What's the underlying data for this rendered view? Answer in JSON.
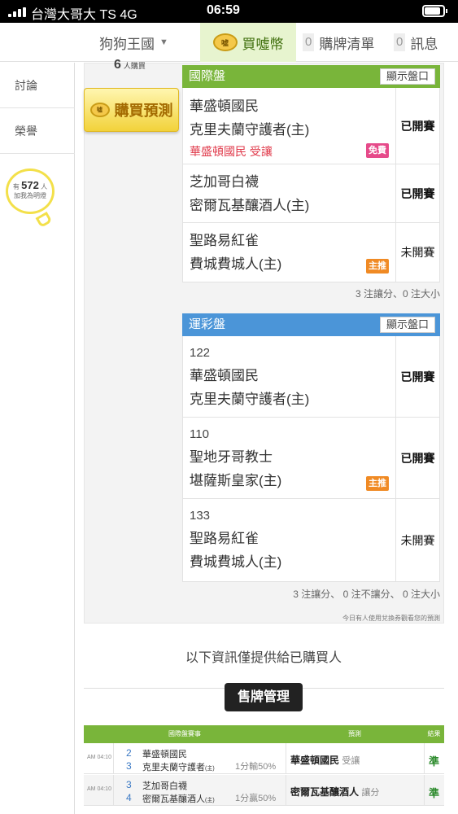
{
  "status_bar": {
    "carrier": "台灣大哥大 TS   4G",
    "time": "06:59",
    "battery_level": 0.85
  },
  "nav": {
    "kingdom": "狗狗王國",
    "coin_logo": "噓",
    "coins": "買噓幣",
    "cart_count": "0",
    "cart": "購牌清單",
    "msg_count": "0",
    "msg": "訊息"
  },
  "sidebar": {
    "discuss": "討論",
    "honor": "榮譽",
    "fans_prefix": "有",
    "fans_count": "572",
    "fans_unit": "人",
    "fans_sub": "加我為明燈"
  },
  "buy": {
    "count": "6",
    "count_unit": "人購買",
    "button": "購買預測"
  },
  "international": {
    "title": "國際盤",
    "show_btn": "顯示盤口",
    "matches": [
      {
        "team1": "華盛頓國民",
        "team2": "克里夫蘭守護者(主)",
        "concede": "華盛頓國民 受讓",
        "tag": "免費",
        "status": "已開賽"
      },
      {
        "team1": "芝加哥白襪",
        "team2": "密爾瓦基釀酒人(主)",
        "status": "已開賽"
      },
      {
        "team1": "聖路易紅雀",
        "team2": "費城費城人(主)",
        "tag": "主推",
        "status": "未開賽"
      }
    ],
    "summary": "3 注讓分、0 注大小"
  },
  "lottery": {
    "title": "運彩盤",
    "show_btn": "顯示盤口",
    "matches": [
      {
        "num": "122",
        "team1": "華盛頓國民",
        "team2": "克里夫蘭守護者(主)",
        "status": "已開賽"
      },
      {
        "num": "110",
        "team1": "聖地牙哥教士",
        "team2": "堪薩斯皇家(主)",
        "tag": "主推",
        "status": "已開賽"
      },
      {
        "num": "133",
        "team1": "聖路易紅雀",
        "team2": "費城費城人(主)",
        "status": "未開賽"
      }
    ],
    "summary": "3 注讓分、 0 注不讓分、 0 注大小",
    "note": "今日有人使用兌換券觀看您的預測"
  },
  "info_text": "以下資訊僅提供給已購買人",
  "sale_button": "售牌管理",
  "table": {
    "headers": [
      "國際盤賽事",
      "預測",
      "結果"
    ],
    "rows": [
      {
        "time": "AM 04:10",
        "n1": "2",
        "t1": "華盛頓國民",
        "n2": "3",
        "t2": "克里夫蘭守護者",
        "home": "(主)",
        "odds": "1分輸50%",
        "pick": "華盛頓國民",
        "pick_note": "受讓",
        "result": "準"
      },
      {
        "time": "AM 04:10",
        "n1": "3",
        "t1": "芝加哥白襪",
        "n2": "4",
        "t2": "密爾瓦基釀酒人",
        "home": "(主)",
        "odds": "1分贏50%",
        "pick": "密爾瓦基釀酒人",
        "pick_note": "讓分",
        "result": "準"
      }
    ]
  },
  "colors": {
    "green": "#79b53a",
    "blue": "#4b95d8",
    "gold": "#f2d23a"
  }
}
